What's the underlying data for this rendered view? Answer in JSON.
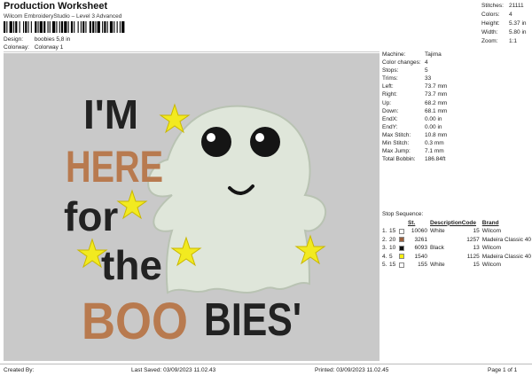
{
  "header": {
    "title": "Production Worksheet",
    "subtitle": "Wilcom EmbroideryStudio – Level 3 Advanced"
  },
  "info": {
    "design_label": "Design:",
    "design_value": "boobies 5,8 in",
    "colorway_label": "Colorway:",
    "colorway_value": "Colorway 1"
  },
  "stats": [
    {
      "label": "Stitches:",
      "value": "21111"
    },
    {
      "label": "Colors:",
      "value": "4"
    },
    {
      "label": "Height:",
      "value": "5.37 in"
    },
    {
      "label": "Width:",
      "value": "5.80 in"
    },
    {
      "label": "Zoom:",
      "value": "1:1"
    }
  ],
  "design_text": {
    "line1": "I'M",
    "line2": "HERE",
    "line3": "for",
    "line4": "the",
    "line5a": "BOO",
    "line5b": "BIES'"
  },
  "colors": {
    "background": "#c9c9c9",
    "orange": "#b87a4f",
    "black": "#222222",
    "ghost": "#dfe6da",
    "star": "#f2ea20"
  },
  "machine": [
    {
      "label": "Machine:",
      "value": "Tajima"
    },
    {
      "label": "Color changes:",
      "value": "4"
    },
    {
      "label": "Stops:",
      "value": "5"
    },
    {
      "label": "Trims:",
      "value": "33"
    },
    {
      "label": "Left:",
      "value": "73.7 mm"
    },
    {
      "label": "Right:",
      "value": "73.7 mm"
    },
    {
      "label": "Up:",
      "value": "68.2 mm"
    },
    {
      "label": "Down:",
      "value": "68.1 mm"
    },
    {
      "label": "EndX:",
      "value": "0.00 in"
    },
    {
      "label": "EndY:",
      "value": "0.00 in"
    },
    {
      "label": "Max Stitch:",
      "value": "10.8 mm"
    },
    {
      "label": "Min Stitch:",
      "value": "0.3 mm"
    },
    {
      "label": "Max Jump:",
      "value": "7.1 mm"
    },
    {
      "label": "Total Bobbin:",
      "value": "186.84ft"
    }
  ],
  "stop_sequence": {
    "title": "Stop Sequence:",
    "headers": {
      "stitches": "St.",
      "description": "Description",
      "code": "Code",
      "brand": "Brand"
    },
    "rows": [
      {
        "n": "1.",
        "stop": "15",
        "color": "#ffffff",
        "stitches": "10060",
        "description": "White",
        "code": "15",
        "brand": "Wilcom"
      },
      {
        "n": "2.",
        "stop": "20",
        "color": "#9a5f3c",
        "stitches": "3261",
        "description": "",
        "code": "1257",
        "brand": "Madeira Classic 40"
      },
      {
        "n": "3.",
        "stop": "10",
        "color": "#111111",
        "stitches": "6093",
        "description": "Black",
        "code": "13",
        "brand": "Wilcom"
      },
      {
        "n": "4.",
        "stop": "5",
        "color": "#f5ee10",
        "stitches": "1540",
        "description": "",
        "code": "1125",
        "brand": "Madeira Classic 40"
      },
      {
        "n": "5.",
        "stop": "15",
        "color": "#ffffff",
        "stitches": "155",
        "description": "White",
        "code": "15",
        "brand": "Wilcom"
      }
    ]
  },
  "footer": {
    "created_by": "Created By:",
    "last_saved": "Last Saved: 03/09/2023 11.02.43",
    "printed": "Printed: 03/09/2023 11.02.45",
    "page": "Page 1 of 1"
  }
}
